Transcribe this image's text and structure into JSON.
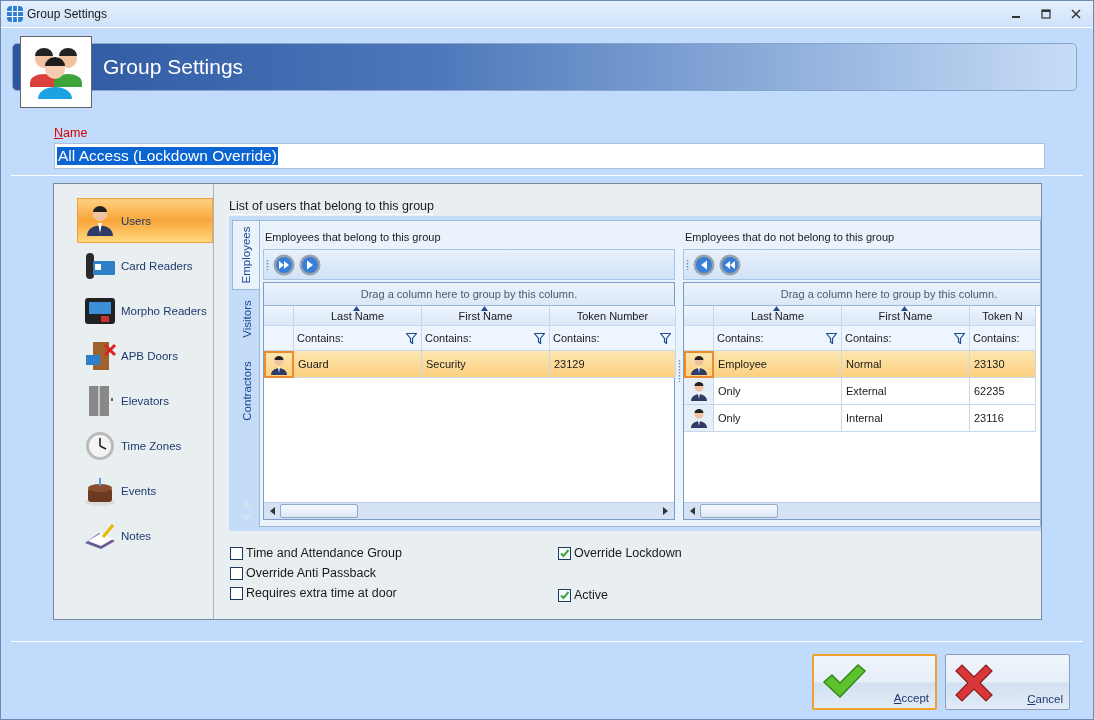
{
  "window": {
    "title": "Group Settings"
  },
  "header": {
    "title": "Group Settings"
  },
  "name_field": {
    "label": "Name",
    "value": "All Access (Lockdown Override)"
  },
  "nav": {
    "items": [
      {
        "label": "Users",
        "selected": true
      },
      {
        "label": "Card Readers",
        "selected": false
      },
      {
        "label": "Morpho Readers",
        "selected": false
      },
      {
        "label": "APB Doors",
        "selected": false
      },
      {
        "label": "Elevators",
        "selected": false
      },
      {
        "label": "Time Zones",
        "selected": false
      },
      {
        "label": "Events",
        "selected": false
      },
      {
        "label": "Notes",
        "selected": false
      }
    ]
  },
  "content": {
    "title": "List of users that belong to this group",
    "side_tabs": [
      {
        "label": "Employees",
        "selected": true
      },
      {
        "label": "Visitors",
        "selected": false
      },
      {
        "label": "Contractors",
        "selected": false
      }
    ],
    "grids": [
      {
        "title": "Employees that belong to this group",
        "tools": [
          {
            "kind": "double_right"
          },
          {
            "kind": "right"
          }
        ],
        "group_hint": "Drag a column here to group by this column.",
        "columns": [
          {
            "label": "Last Name",
            "sorted": true,
            "filter": "Contains:",
            "filter_icon": true
          },
          {
            "label": "First Name",
            "sorted": true,
            "filter": "Contains:",
            "filter_icon": true
          },
          {
            "label": "Token Number",
            "sorted": false,
            "filter": "Contains:",
            "filter_icon": true
          }
        ],
        "rows": [
          {
            "cells": [
              "Guard",
              "Security",
              "23129"
            ],
            "selected": true
          }
        ]
      },
      {
        "title": "Employees that do not belong to this group",
        "tools": [
          {
            "kind": "left"
          },
          {
            "kind": "double_left"
          }
        ],
        "group_hint": "Drag a column here to group by this column.",
        "columns": [
          {
            "label": "Last Name",
            "sorted": true,
            "filter": "Contains:",
            "filter_icon": true
          },
          {
            "label": "First Name",
            "sorted": true,
            "filter": "Contains:",
            "filter_icon": true
          },
          {
            "label": "Token N",
            "sorted": false,
            "filter": "Contains:",
            "filter_icon": false
          }
        ],
        "rows": [
          {
            "cells": [
              "Employee",
              "Normal",
              "23130"
            ],
            "selected": true
          },
          {
            "cells": [
              "Only",
              "External",
              "62235"
            ],
            "selected": false
          },
          {
            "cells": [
              "Only",
              "Internal",
              "23116"
            ],
            "selected": false
          }
        ]
      }
    ]
  },
  "options": [
    {
      "label": "Time and Attendance Group",
      "checked": false
    },
    {
      "label": "Override Anti Passback",
      "checked": false
    },
    {
      "label": "Requires extra time at door",
      "checked": false
    },
    {
      "label": "Override Lockdown",
      "checked": true
    },
    {
      "label": "Active",
      "checked": true
    }
  ],
  "buttons": [
    {
      "kind": "accept",
      "label": "Accept",
      "focused": true
    },
    {
      "kind": "cancel",
      "label": "Cancel",
      "focused": false
    }
  ]
}
